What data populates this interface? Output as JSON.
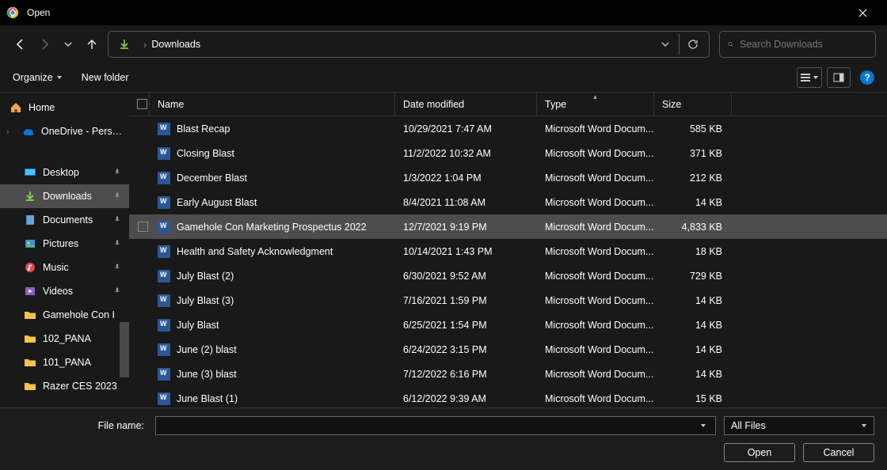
{
  "titlebar": {
    "title": "Open"
  },
  "address": {
    "location": "Downloads"
  },
  "search": {
    "placeholder": "Search Downloads"
  },
  "toolbar": {
    "organize": "Organize",
    "new_folder": "New folder"
  },
  "sidebar": {
    "home": "Home",
    "onedrive": "OneDrive - Pers…",
    "quick": [
      {
        "label": "Desktop",
        "icon": "desktop"
      },
      {
        "label": "Downloads",
        "icon": "downloads",
        "selected": true
      },
      {
        "label": "Documents",
        "icon": "documents"
      },
      {
        "label": "Pictures",
        "icon": "pictures"
      },
      {
        "label": "Music",
        "icon": "music"
      },
      {
        "label": "Videos",
        "icon": "videos"
      }
    ],
    "folders": [
      {
        "label": "Gamehole Con I"
      },
      {
        "label": "102_PANA"
      },
      {
        "label": "101_PANA"
      },
      {
        "label": "Razer CES 2023"
      }
    ]
  },
  "columns": {
    "name": "Name",
    "date": "Date modified",
    "type": "Type",
    "size": "Size"
  },
  "files": [
    {
      "name": "Blast Recap",
      "date": "10/29/2021 7:47 AM",
      "type": "Microsoft Word Docum...",
      "size": "585 KB"
    },
    {
      "name": "Closing Blast",
      "date": "11/2/2022 10:32 AM",
      "type": "Microsoft Word Docum...",
      "size": "371 KB"
    },
    {
      "name": "December Blast",
      "date": "1/3/2022 1:04 PM",
      "type": "Microsoft Word Docum...",
      "size": "212 KB"
    },
    {
      "name": "Early August Blast",
      "date": "8/4/2021 11:08 AM",
      "type": "Microsoft Word Docum...",
      "size": "14 KB"
    },
    {
      "name": "Gamehole Con Marketing Prospectus 2022",
      "date": "12/7/2021 9:19 PM",
      "type": "Microsoft Word Docum...",
      "size": "4,833 KB",
      "selected": true
    },
    {
      "name": "Health and Safety Acknowledgment",
      "date": "10/14/2021 1:43 PM",
      "type": "Microsoft Word Docum...",
      "size": "18 KB"
    },
    {
      "name": "July Blast (2)",
      "date": "6/30/2021 9:52 AM",
      "type": "Microsoft Word Docum...",
      "size": "729 KB"
    },
    {
      "name": "July Blast (3)",
      "date": "7/16/2021 1:59 PM",
      "type": "Microsoft Word Docum...",
      "size": "14 KB"
    },
    {
      "name": "July Blast",
      "date": "6/25/2021 1:54 PM",
      "type": "Microsoft Word Docum...",
      "size": "14 KB"
    },
    {
      "name": "June (2) blast",
      "date": "6/24/2022 3:15 PM",
      "type": "Microsoft Word Docum...",
      "size": "14 KB"
    },
    {
      "name": "June (3) blast",
      "date": "7/12/2022 6:16 PM",
      "type": "Microsoft Word Docum...",
      "size": "14 KB"
    },
    {
      "name": "June Blast (1)",
      "date": "6/12/2022 9:39 AM",
      "type": "Microsoft Word Docum...",
      "size": "15 KB"
    }
  ],
  "bottom": {
    "filename_label": "File name:",
    "filename_value": "",
    "filter": "All Files",
    "open": "Open",
    "cancel": "Cancel"
  }
}
